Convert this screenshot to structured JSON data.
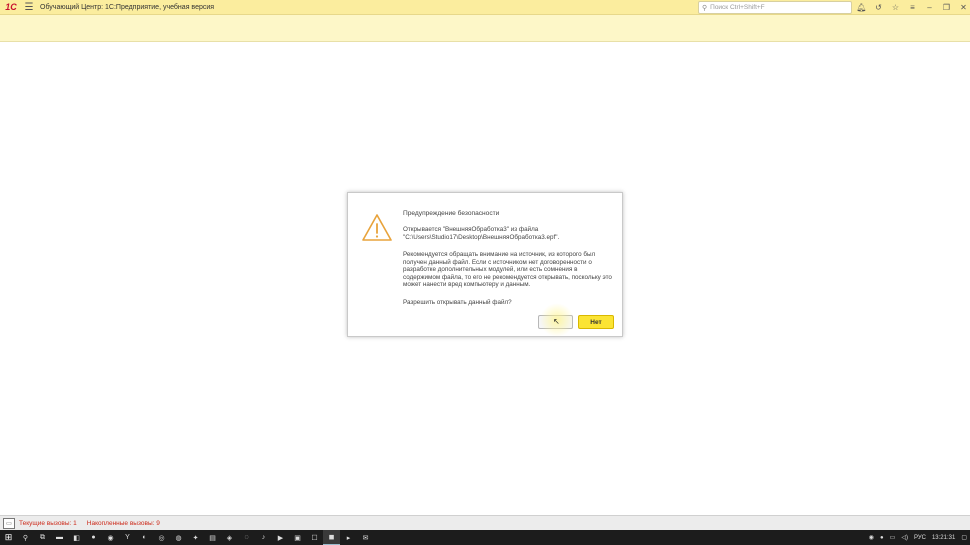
{
  "titlebar": {
    "logo_text": "1С",
    "title": "Обучающий Центр: 1С:Предприятие, учебная версия",
    "search_placeholder": "Поиск Ctrl+Shift+F",
    "icons": [
      "bell-icon",
      "history-icon",
      "star-icon",
      "menu-list-icon",
      "minimize-icon",
      "restore-icon",
      "close-icon"
    ]
  },
  "dialog": {
    "title": "Предупреждение безопасности",
    "open_text": "Открывается \"ВнешняяОбработка3\" из файла\n\"C:\\Users\\Studio17\\Desktop\\ВнешняяОбработка3.epf\".",
    "recommend_text": "Рекомендуется обращать внимание на источник, из которого был получен данный файл. Если с источником нет договоренности о разработке дополнительных модулей, или есть сомнения в содержимом файла, то его не рекомендуется открывать, поскольку это может нанести вред компьютеру и данным.",
    "question": "Разрешить открывать данный файл?",
    "yes_label": "",
    "no_label": "Нет",
    "warning_color": "#e8a33b",
    "no_button_color": "#fbe434"
  },
  "statusbar": {
    "current_calls": "Текущие вызовы: 1",
    "accumulated_calls": "Накопленные вызовы: 9"
  },
  "taskbar": {
    "tray_lang": "РУС",
    "tray_time": "13:21:31"
  },
  "colors": {
    "titlebar_bg": "#fbed9e",
    "status_text": "#cc2a1a",
    "taskbar_bg": "#1c1c1c"
  }
}
